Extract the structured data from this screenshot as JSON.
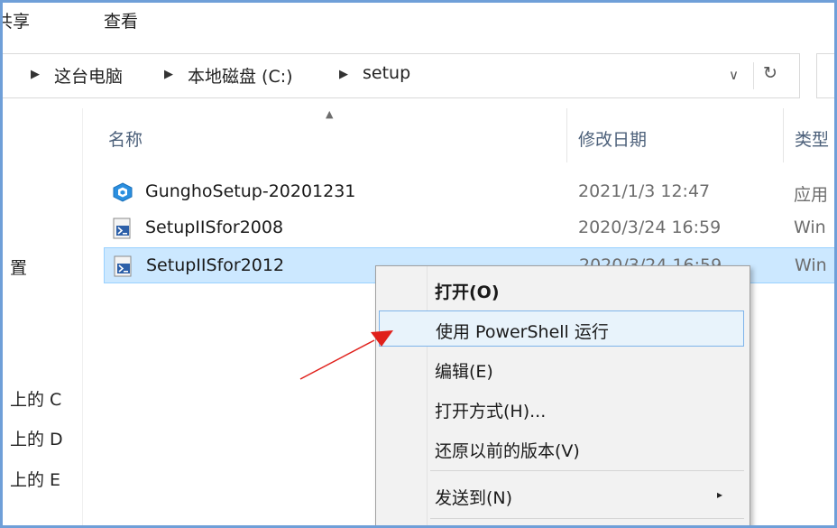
{
  "ribbon": {
    "tabs": [
      "共享",
      "查看"
    ]
  },
  "address": {
    "crumbs": [
      "这台电脑",
      "本地磁盘 (C:)",
      "setup"
    ],
    "dropdown_glyph": "∨",
    "refresh_glyph": "↻"
  },
  "nav": {
    "items": [
      "置",
      "上的 C",
      "上的 D",
      "上的 E"
    ]
  },
  "columns": {
    "name": "名称",
    "date": "修改日期",
    "type": "类型"
  },
  "files": [
    {
      "name": "GunghoSetup-20201231",
      "date": "2021/1/3 12:47",
      "type": "应用",
      "icon": "app-icon"
    },
    {
      "name": "SetupIISfor2008",
      "date": "2020/3/24 16:59",
      "type": "Win",
      "icon": "powershell-script-icon"
    },
    {
      "name": "SetupIISfor2012",
      "date": "2020/3/24 16:59",
      "type": "Win",
      "icon": "powershell-script-icon"
    }
  ],
  "context_menu": {
    "open": "打开(O)",
    "run_powershell": "使用 PowerShell 运行",
    "edit": "编辑(E)",
    "open_with": "打开方式(H)...",
    "restore": "还原以前的版本(V)",
    "send_to": "发送到(N)",
    "submenu_glyph": "▸"
  },
  "colors": {
    "selection": "#cce8ff",
    "menu_hover_border": "#7eb4ea",
    "annotation": "#e0201b",
    "frame": "#6f9fd8"
  }
}
